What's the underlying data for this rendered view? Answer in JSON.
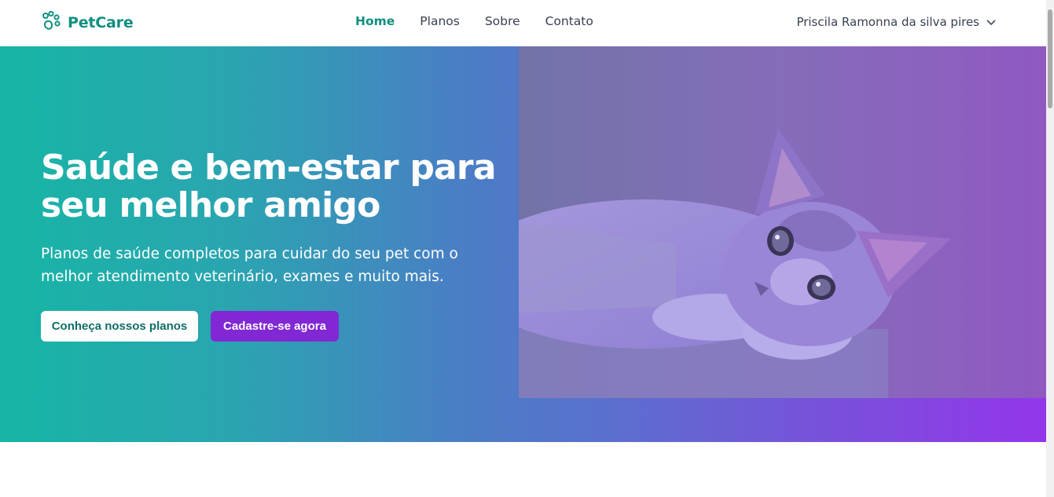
{
  "navbar": {
    "brand": {
      "name": "PetCare",
      "icon": "paw-icon"
    },
    "links": [
      {
        "label": "Home",
        "active": true
      },
      {
        "label": "Planos",
        "active": false
      },
      {
        "label": "Sobre",
        "active": false
      },
      {
        "label": "Contato",
        "active": false
      }
    ],
    "user": {
      "name": "Priscila Ramonna da silva pires",
      "icon": "chevron-down-icon"
    }
  },
  "hero": {
    "title": "Saúde e bem-estar para seu melhor amigo",
    "subtitle": "Planos de saúde completos para cuidar do seu pet com o melhor atendimento veterinário, exames e muito mais.",
    "primary_button": "Conheça nossos planos",
    "secondary_button": "Cadastre-se agora",
    "image": "kitten-photo"
  },
  "colors": {
    "brand": "#0f8f80",
    "gradient_start": "#17b5a5",
    "gradient_end": "#9336ea",
    "signup_button": "#8128d4"
  }
}
